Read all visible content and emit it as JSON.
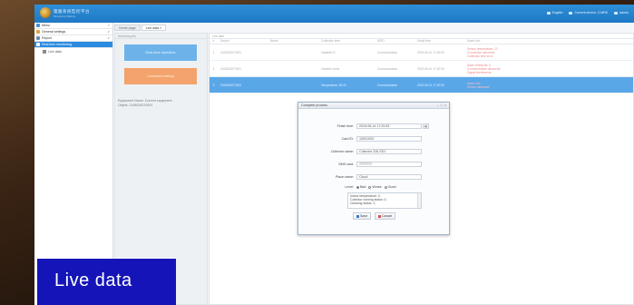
{
  "header": {
    "app_title": "電腦系统監控平台",
    "app_subtitle": "Monitoring Platform",
    "language": "English",
    "current_device": "Current device: Z-MRK",
    "user": "admin"
  },
  "sidebar": {
    "items": [
      {
        "label": "Menu",
        "color": "#4a90d9"
      },
      {
        "label": "General settings",
        "color": "#e0a23a"
      },
      {
        "label": "Report",
        "color": "#6c8bb0"
      },
      {
        "label": "Real time monitoring",
        "color": "#ffffff",
        "active": true
      }
    ],
    "sub_items": [
      {
        "label": "Live data"
      }
    ]
  },
  "tabs": [
    {
      "label": "Home page"
    },
    {
      "label": "Live data ×",
      "active": true
    }
  ],
  "left_panel": {
    "header": "Monitoring list",
    "btn_primary": "Real-time operation",
    "btn_secondary": "Command history",
    "equipment_label": "Equipment Name: Current equipment",
    "equipment_value": "Object: 2108020070001"
  },
  "grid": {
    "toolbar": "Live data",
    "columns": [
      "#",
      "Device",
      "Name",
      "Collection time",
      "NSID",
      "Detail time",
      "Alarm info"
    ],
    "rows": [
      {
        "no": "1",
        "device": "2108020070001",
        "name": "",
        "col3": "Variable 01",
        "col4": "Communication",
        "col5": "2019-06-14 17:20:53",
        "alarm": "Sensor temperature: 23\nConnection abnormal\nCollection time error"
      },
      {
        "no": "2",
        "device": "2108020070001",
        "name": "",
        "col3": "Variable name",
        "col4": "Communication",
        "col5": "2019-06-14 17:20:53",
        "alarm": "Alarm threshold: 0\nCommunication abnormal\nSignal interference"
      },
      {
        "no": "3",
        "device": "2108020070001",
        "name": "",
        "col3": "Temperature: 26.00",
        "col4": "Communication",
        "col5": "2019-06-14 17:20:53",
        "alarm": "Alarm info\nSensor abnormal",
        "selected": true
      }
    ]
  },
  "dialog": {
    "title": "Complete process",
    "fields": [
      {
        "label": "Finish time:",
        "value": "2019-06-14 17:20:53"
      },
      {
        "label": "Card ID:",
        "value": "10001003"
      },
      {
        "label": "Collector name:",
        "value": "Collector 226-SD1"
      },
      {
        "label": "SMS card:",
        "value": "7777777"
      },
      {
        "label": "Place name:",
        "value": "Cloud"
      }
    ],
    "level_label": "Level:",
    "levels": [
      {
        "label": "Bad",
        "checked": true
      },
      {
        "label": "Worse",
        "checked": false
      },
      {
        "label": "Good",
        "checked": false
      }
    ],
    "remark": "Indoor temperature: 0;\nCollector running status: 0;\nCleaning status: 1;",
    "save": "Save",
    "cancel": "Cancel"
  },
  "caption": "Live data"
}
